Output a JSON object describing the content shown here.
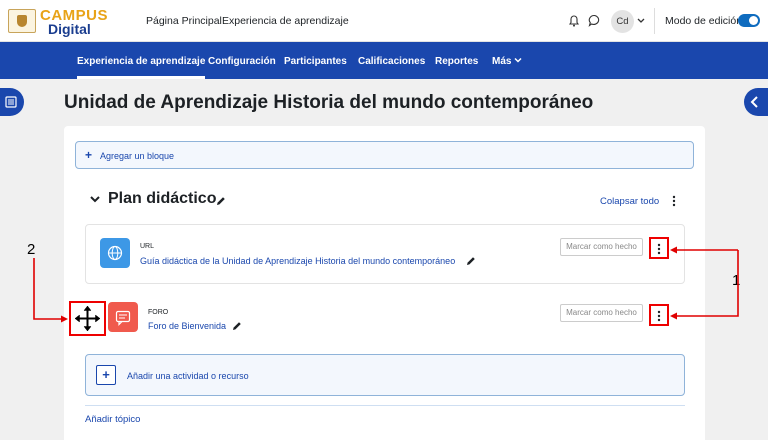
{
  "header": {
    "logo_line1": "CAMPUS",
    "logo_line2": "Digital",
    "links": [
      "Página Principal",
      "Experiencia de aprendizaje"
    ],
    "avatar_initials": "Cd",
    "edit_mode_label": "Modo de edición"
  },
  "secondary_nav": {
    "items": [
      "Experiencia de aprendizaje",
      "Configuración",
      "Participantes",
      "Calificaciones",
      "Reportes",
      "Más"
    ]
  },
  "page_title": "Unidad de Aprendizaje Historia del mundo contemporáneo",
  "add_block_label": "Agregar un bloque",
  "section": {
    "title": "Plan didáctico",
    "collapse_all": "Colapsar todo"
  },
  "activities": [
    {
      "type": "URL",
      "name": "Guía didáctica de la Unidad de Aprendizaje Historia del mundo contemporáneo",
      "mark_done": "Marcar como hecho"
    },
    {
      "type": "FORO",
      "name": "Foro de Bienvenida",
      "mark_done": "Marcar como hecho"
    }
  ],
  "add_activity_label": "Añadir una actividad o recurso",
  "add_topic_label": "Añadir tópico",
  "callouts": {
    "one": "1",
    "two": "2"
  },
  "colors": {
    "brand_blue": "#1a47ad",
    "callout_red": "#e00000",
    "url_icon": "#3d98e6",
    "forum_icon": "#f05a4d"
  }
}
